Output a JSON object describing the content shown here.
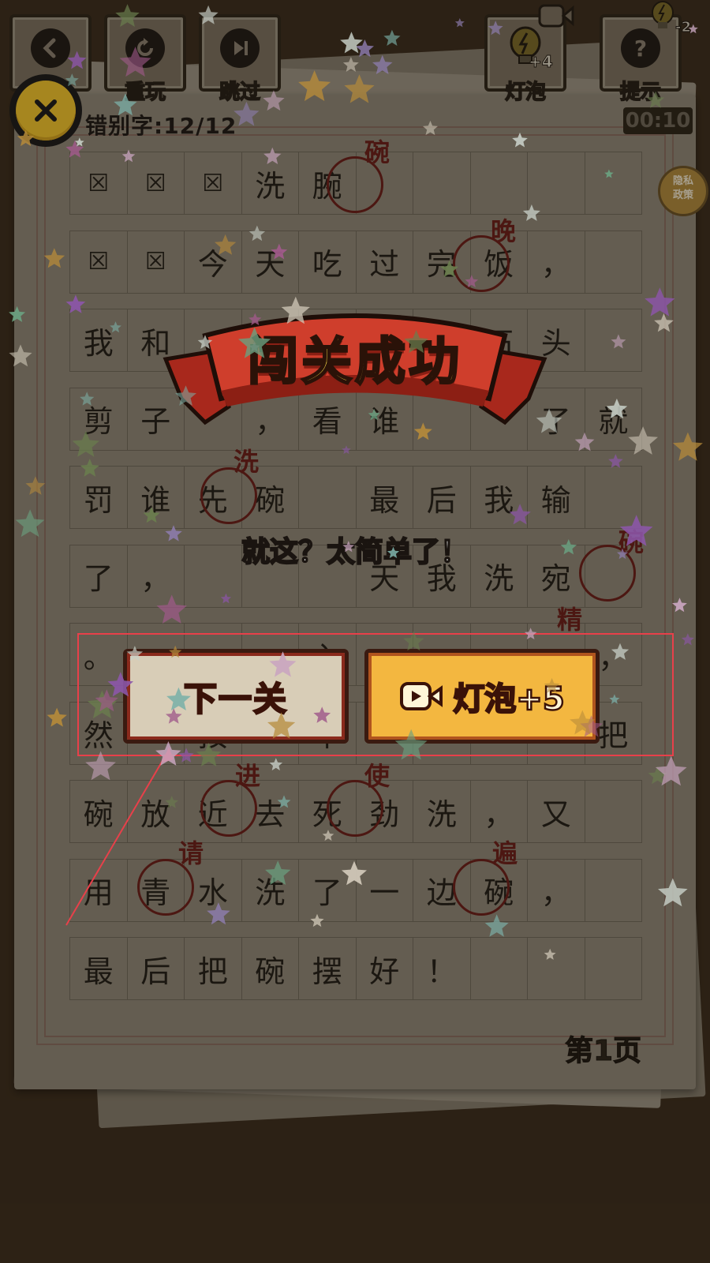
{
  "toolbar": {
    "back_label": "返回",
    "replay_label": "重玩",
    "skip_label": "跳过",
    "bulb_label": "灯泡",
    "bulb_count": "+4",
    "hint_label": "提示",
    "hint_cost": "-2"
  },
  "status": {
    "error_count": "错别字:12/12",
    "timer": "00:10"
  },
  "privacy": {
    "line1": "隐私",
    "line2": "政策"
  },
  "grid": {
    "rows": [
      [
        "☒",
        "☒",
        "☒",
        "洗",
        "腕",
        "",
        "",
        "",
        "",
        ""
      ],
      [
        "☒",
        "☒",
        "今",
        "天",
        "吃",
        "过",
        "完",
        "饭",
        "，",
        ""
      ],
      [
        "我",
        "和",
        "",
        "",
        "",
        "",
        "",
        "石",
        "头",
        ""
      ],
      [
        "剪",
        "子",
        "",
        "，",
        "看",
        "谁",
        "",
        "",
        "了",
        "就"
      ],
      [
        "罚",
        "谁",
        "先",
        "碗",
        "",
        "最",
        "后",
        "我",
        "输",
        ""
      ],
      [
        "了",
        "，",
        "",
        "",
        "",
        "天",
        "我",
        "洗",
        "宛",
        ""
      ],
      [
        "。",
        "",
        "",
        "",
        "入",
        "",
        "",
        "",
        "",
        "，"
      ],
      [
        "然",
        "",
        "按",
        "",
        "半",
        "",
        "",
        "",
        "",
        "把"
      ],
      [
        "碗",
        "放",
        "近",
        "去",
        "死",
        "劲",
        "洗",
        "，",
        "又",
        ""
      ],
      [
        "用",
        "青",
        "水",
        "洗",
        "了",
        "一",
        "边",
        "碗",
        "，",
        ""
      ],
      [
        "最",
        "后",
        "把",
        "碗",
        "摆",
        "好",
        "！",
        "",
        "",
        ""
      ]
    ],
    "corrections": [
      "碗",
      "晚",
      "洗",
      "碗",
      "精",
      "进",
      "使",
      "请",
      "遍"
    ]
  },
  "page_number": "第1页",
  "dialog": {
    "title": "闯关成功",
    "subtitle": "就这？太简单了！",
    "next_label": "下一关",
    "video_label": "灯泡+5"
  },
  "colors": {
    "accent_yellow": "#f4c72c",
    "banner_red": "#c23a2a",
    "highlight_red": "#e8404a"
  }
}
